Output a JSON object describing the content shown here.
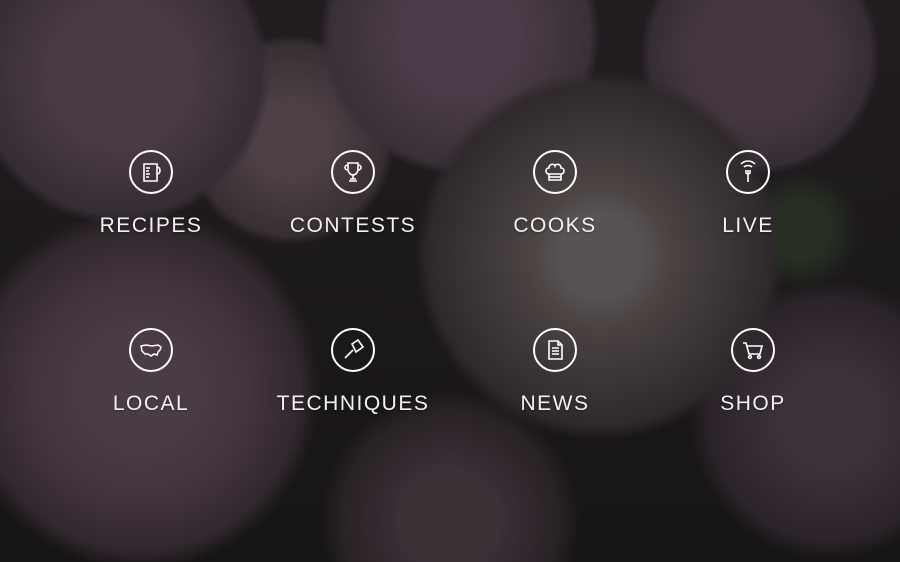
{
  "menu": {
    "items": [
      {
        "label": "RECIPES",
        "icon": "measuring-cup-icon"
      },
      {
        "label": "CONTESTS",
        "icon": "trophy-icon"
      },
      {
        "label": "COOKS",
        "icon": "chef-hat-icon"
      },
      {
        "label": "LIVE",
        "icon": "fork-signal-icon"
      },
      {
        "label": "LOCAL",
        "icon": "usa-map-icon"
      },
      {
        "label": "TECHNIQUES",
        "icon": "cleaver-icon"
      },
      {
        "label": "NEWS",
        "icon": "document-icon"
      },
      {
        "label": "SHOP",
        "icon": "shopping-cart-icon"
      }
    ]
  },
  "colors": {
    "icon_stroke": "#ffffff",
    "label_text": "#f2f2f2"
  }
}
